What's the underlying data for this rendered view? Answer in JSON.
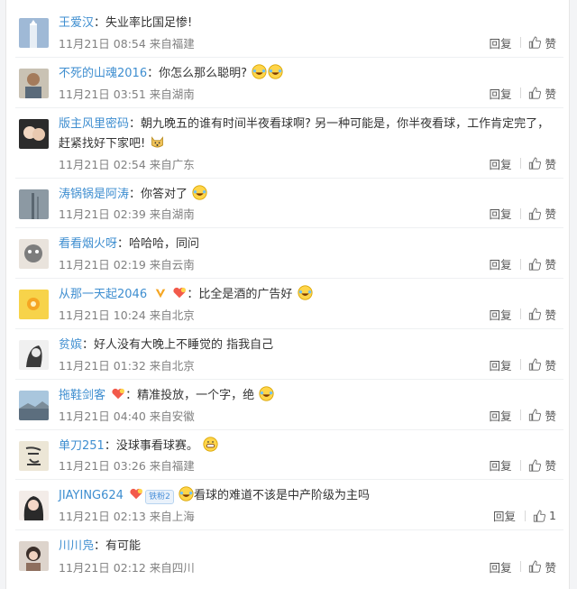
{
  "ui": {
    "reply_label": "回复",
    "like_label": "赞"
  },
  "comments": [
    {
      "user": "王爱汉",
      "sep": "：",
      "text": "失业率比国足惨!",
      "time": "11月21日 08:54",
      "location": "来自福建",
      "reply": "回复",
      "likes": "赞"
    },
    {
      "user": "不死的山魂2016",
      "sep": "：",
      "text": "你怎么那么聪明?",
      "time": "11月21日 03:51",
      "location": "来自湖南",
      "reply": "回复",
      "likes": "赞"
    },
    {
      "user": "版主风里密码",
      "sep": "：",
      "text": "朝九晚五的谁有时间半夜看球啊? 另一种可能是，你半夜看球，工作肯定完了，赶紧找好下家吧!",
      "time": "11月21日 02:54",
      "location": "来自广东",
      "reply": "回复",
      "likes": "赞"
    },
    {
      "user": "涛锅锅是阿涛",
      "sep": "：",
      "text": "你答对了",
      "time": "11月21日 02:39",
      "location": "来自湖南",
      "reply": "回复",
      "likes": "赞"
    },
    {
      "user": "看看烟火呀",
      "sep": "：",
      "text": "哈哈哈，同问",
      "time": "11月21日 02:19",
      "location": "来自云南",
      "reply": "回复",
      "likes": "赞"
    },
    {
      "user": "从那一天起2046",
      "sep": "：",
      "text": "比全是酒的广告好",
      "time": "11月21日 10:24",
      "location": "来自北京",
      "reply": "回复",
      "likes": "赞"
    },
    {
      "user": "贫嫔",
      "sep": "：",
      "text": "好人没有大晚上不睡觉的 指我自己",
      "time": "11月21日 01:32",
      "location": "来自北京",
      "reply": "回复",
      "likes": "赞"
    },
    {
      "user": "拖鞋剑客",
      "sep": "：",
      "text": "精准投放，一个字，绝",
      "time": "11月21日 04:40",
      "location": "来自安徽",
      "reply": "回复",
      "likes": "赞"
    },
    {
      "user": "单刀251",
      "sep": "：",
      "text": "没球事看球赛。",
      "time": "11月21日 03:26",
      "location": "来自福建",
      "reply": "回复",
      "likes": "赞"
    },
    {
      "user": "JIAYING624",
      "sep": "：",
      "text": "看球的难道不该是中产阶级为主吗",
      "time": "11月21日 02:13",
      "location": "来自上海",
      "reply": "回复",
      "likes": "1",
      "badge": "铁粉2"
    },
    {
      "user": "川川凫",
      "sep": "：",
      "text": "有可能",
      "time": "11月21日 02:12",
      "location": "来自四川",
      "reply": "回复",
      "likes": "赞"
    }
  ]
}
